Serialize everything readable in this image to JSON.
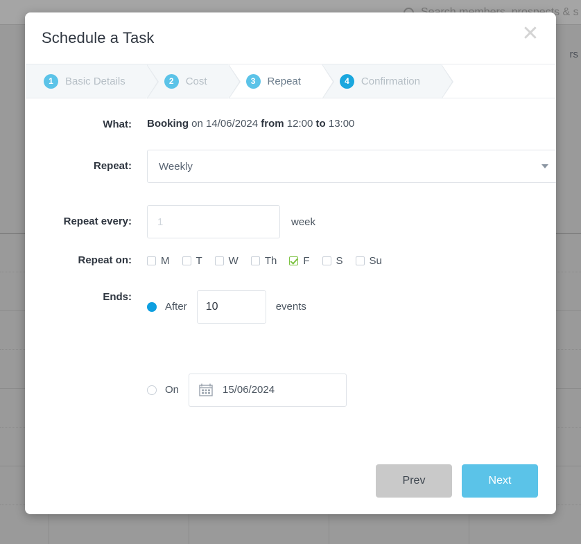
{
  "background": {
    "search_placeholder": "Search members, prospects & s",
    "search_icon": "search-icon",
    "right_fragment": "rs"
  },
  "modal": {
    "title": "Schedule a Task",
    "close_icon": "✕",
    "steps": [
      {
        "number": "1",
        "label": "Basic Details",
        "active": false
      },
      {
        "number": "2",
        "label": "Cost",
        "active": false
      },
      {
        "number": "3",
        "label": "Repeat",
        "active": true
      },
      {
        "number": "4",
        "label": "Confirmation",
        "active": false
      }
    ],
    "what": {
      "label": "What:",
      "type": "Booking",
      "on_word": "on",
      "date": "14/06/2024",
      "from_word": "from",
      "start_time": "12:00",
      "to_word": "to",
      "end_time": "13:00"
    },
    "repeat": {
      "label": "Repeat:",
      "value": "Weekly",
      "caret_icon": "chevron-down-icon"
    },
    "repeat_every": {
      "label": "Repeat every:",
      "value": "",
      "placeholder": "1",
      "unit": "week"
    },
    "repeat_on": {
      "label": "Repeat on:",
      "days": [
        {
          "label": "M",
          "checked": false
        },
        {
          "label": "T",
          "checked": false
        },
        {
          "label": "W",
          "checked": false
        },
        {
          "label": "Th",
          "checked": false
        },
        {
          "label": "F",
          "checked": true
        },
        {
          "label": "S",
          "checked": false
        },
        {
          "label": "Su",
          "checked": false
        }
      ]
    },
    "ends": {
      "label": "Ends:",
      "after": {
        "radio_label": "After",
        "selected": true,
        "value": "10",
        "unit": "events"
      },
      "on": {
        "radio_label": "On",
        "selected": false,
        "date": "15/06/2024",
        "calendar_icon": "calendar-icon"
      }
    },
    "footer": {
      "prev_label": "Prev",
      "next_label": "Next"
    }
  },
  "colors": {
    "accent": "#5bc3e8",
    "accent_dark": "#1aa7de",
    "radio_selected": "#0e9fe0",
    "check_green": "#7dc242",
    "prev_grey": "#c9c9c9",
    "text_dark": "#2f3640"
  }
}
